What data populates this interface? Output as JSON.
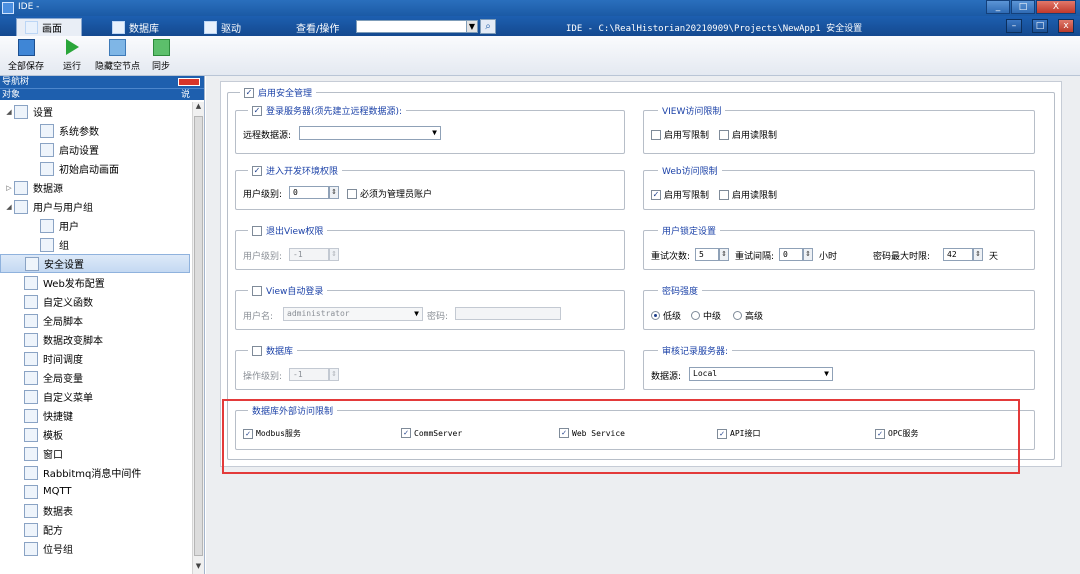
{
  "window": {
    "title": "IDE -",
    "controls": [
      "_",
      "□",
      "X"
    ]
  },
  "menubar": {
    "tabs": [
      "画面",
      "数据库",
      "驱动"
    ],
    "view_label": "查看/操作",
    "search_value": "",
    "path": "IDE - C:\\RealHistorian20210909\\Projects\\NewApp1  安全设置",
    "right_controls": [
      "–",
      "□",
      "x"
    ]
  },
  "toolbar": {
    "buttons": [
      "全部保存",
      "运行",
      "隐藏空节点",
      "同步"
    ]
  },
  "nav": {
    "title": "导航树",
    "col_label": "对象",
    "col_right": "说",
    "items": [
      {
        "label": "设置",
        "arrow": "◢",
        "level": 0,
        "icon": "settings-icon"
      },
      {
        "label": "系统参数",
        "arrow": "",
        "level": 2,
        "icon": "system-params-icon"
      },
      {
        "label": "启动设置",
        "arrow": "",
        "level": 2,
        "icon": "startup-settings-icon"
      },
      {
        "label": "初始启动画面",
        "arrow": "",
        "level": 2,
        "icon": "startup-screen-icon"
      },
      {
        "label": "数据源",
        "arrow": "▷",
        "level": 0,
        "icon": "datasource-icon"
      },
      {
        "label": "用户与用户组",
        "arrow": "◢",
        "level": 0,
        "icon": "users-groups-icon"
      },
      {
        "label": "用户",
        "arrow": "",
        "level": 2,
        "icon": "user-icon"
      },
      {
        "label": "组",
        "arrow": "",
        "level": 2,
        "icon": "group-icon"
      },
      {
        "label": "安全设置",
        "arrow": "",
        "level": 1,
        "icon": "security-icon"
      },
      {
        "label": "Web发布配置",
        "arrow": "",
        "level": 1,
        "icon": "web-publish-icon"
      },
      {
        "label": "自定义函数",
        "arrow": "",
        "level": 1,
        "icon": "custom-function-icon"
      },
      {
        "label": "全局脚本",
        "arrow": "",
        "level": 1,
        "icon": "global-script-icon"
      },
      {
        "label": "数据改变脚本",
        "arrow": "",
        "level": 1,
        "icon": "data-change-script-icon"
      },
      {
        "label": "时间调度",
        "arrow": "",
        "level": 1,
        "icon": "time-schedule-icon"
      },
      {
        "label": "全局变量",
        "arrow": "",
        "level": 1,
        "icon": "global-variable-icon"
      },
      {
        "label": "自定义菜单",
        "arrow": "",
        "level": 1,
        "icon": "custom-menu-icon"
      },
      {
        "label": "快捷键",
        "arrow": "",
        "level": 1,
        "icon": "shortcut-icon"
      },
      {
        "label": "模板",
        "arrow": "",
        "level": 1,
        "icon": "template-icon"
      },
      {
        "label": "窗口",
        "arrow": "",
        "level": 1,
        "icon": "window-icon"
      },
      {
        "label": "Rabbitmq消息中间件",
        "arrow": "",
        "level": 1,
        "icon": "rabbitmq-icon"
      },
      {
        "label": "MQTT",
        "arrow": "",
        "level": 1,
        "icon": "mqtt-icon"
      },
      {
        "label": "数据表",
        "arrow": "",
        "level": 1,
        "icon": "data-table-icon"
      },
      {
        "label": "配方",
        "arrow": "",
        "level": 1,
        "icon": "recipe-icon"
      },
      {
        "label": "位号组",
        "arrow": "",
        "level": 1,
        "icon": "tag-group-icon"
      }
    ]
  },
  "security": {
    "enable_label": "启用安全管理",
    "login_server": {
      "label": "登录服务器(须先建立远程数据源):",
      "remote_label": "远程数据源:",
      "remote_value": ""
    },
    "dev_env": {
      "label": "进入开发环境权限",
      "level_label": "用户级别:",
      "level_value": "0",
      "admin_label": "必须为管理员账户"
    },
    "exit_view": {
      "label": "退出View权限",
      "level_label": "用户级别:",
      "level_value": "-1"
    },
    "view_autologin": {
      "label": "View自动登录",
      "user_label": "用户名:",
      "user_value": "administrator",
      "pwd_label": "密码:",
      "pwd_value": ""
    },
    "database": {
      "label": "数据库",
      "level_label": "操作级别:",
      "level_value": "-1"
    },
    "view_access": {
      "label": "VIEW访问限制",
      "write": "启用写限制",
      "read": "启用读限制"
    },
    "web_access": {
      "label": "Web访问限制",
      "write": "启用写限制",
      "read": "启用读限制"
    },
    "lock": {
      "label": "用户锁定设置",
      "retry_label": "重试次数:",
      "retry_value": "5",
      "interval_label": "重试间隔:",
      "interval_value": "0",
      "hours": "小时",
      "maxdays_label": "密码最大时限:",
      "maxdays_value": "42",
      "days": "天"
    },
    "pwd_strength": {
      "label": "密码强度",
      "options": [
        "低级",
        "中级",
        "高级"
      ],
      "selected": "低级"
    },
    "audit": {
      "label": "审核记录服务器:",
      "source_label": "数据源:",
      "source_value": "Local"
    },
    "external": {
      "label": "数据库外部访问限制",
      "items": [
        "Modbus服务",
        "CommServer",
        "Web Service",
        "API接口",
        "OPC服务"
      ]
    }
  }
}
